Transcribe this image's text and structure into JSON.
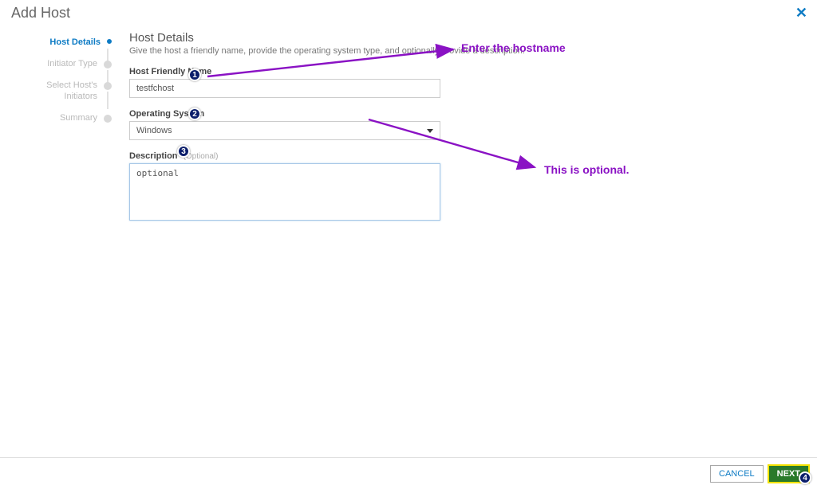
{
  "dialog": {
    "title": "Add Host"
  },
  "steps": [
    {
      "label": "Host Details",
      "active": true
    },
    {
      "label": "Initiator Type",
      "active": false
    },
    {
      "label": "Select Host's Initiators",
      "active": false
    },
    {
      "label": "Summary",
      "active": false
    }
  ],
  "form": {
    "section_title": "Host Details",
    "section_desc": "Give the host a friendly name, provide the operating system type, and optionally provide a description.",
    "name_label": "Host Friendly Name",
    "name_value": "testfchost",
    "os_label": "Operating System",
    "os_value": "Windows",
    "desc_label": "Description",
    "desc_hint": "(Optional)",
    "desc_value": "optional"
  },
  "buttons": {
    "cancel": "CANCEL",
    "next": "NEXT"
  },
  "annotations": {
    "hostname": "Enter the hostname",
    "optional": "This is optional.",
    "b1": "1",
    "b2": "2",
    "b3": "3",
    "b4": "4"
  }
}
